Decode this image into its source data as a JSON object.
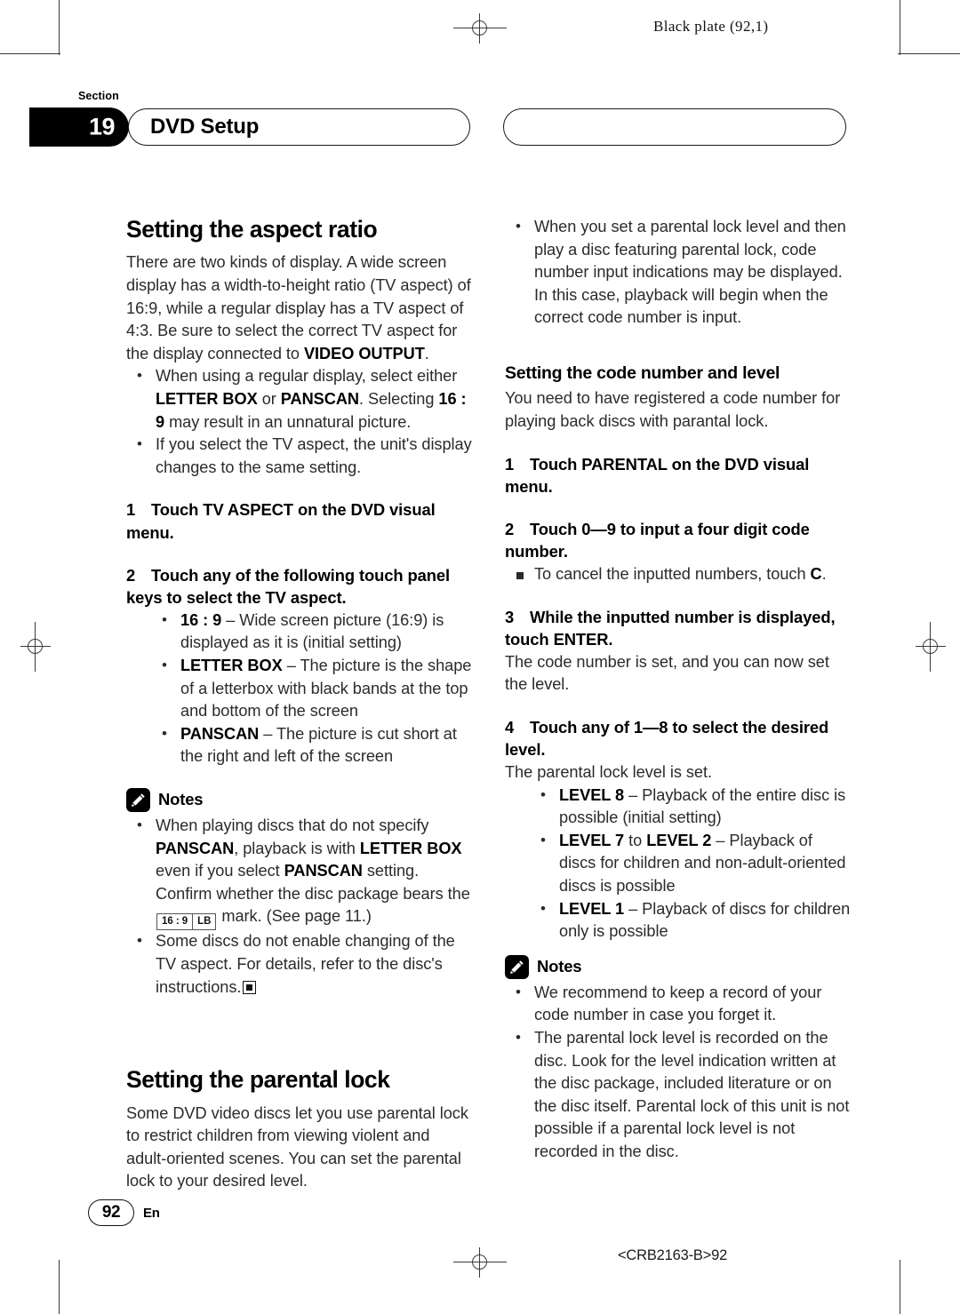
{
  "plate_label": "Black plate (92,1)",
  "header": {
    "section_word": "Section",
    "section_number": "19",
    "left_tab_title": "DVD Setup",
    "right_tab_title": ""
  },
  "left_column": {
    "heading": "Setting the aspect ratio",
    "intro_html": "There are two kinds of display. A wide screen display has a width-to-height ratio (TV aspect) of 16:9, while a regular display has a TV aspect of 4:3. Be sure to select the correct TV aspect for the display connected to <b>VIDEO OUTPUT</b>.",
    "intro_bullets_html": [
      "When using a regular display, select either <b>LETTER BOX</b> or <b>PANSCAN</b>. Selecting <b>16 : 9</b> may result in an unnatural picture.",
      "If you select the TV aspect, the unit's display changes to the same setting."
    ],
    "step1": "Touch TV ASPECT on the DVD visual menu.",
    "step1_num": "1",
    "step2": "Touch any of the following touch panel keys to select the TV aspect.",
    "step2_num": "2",
    "step2_bullets_html": [
      "<b>16 : 9</b> – Wide screen picture (16:9) is displayed as it is (initial setting)",
      "<b>LETTER BOX</b> – The picture is the shape of a letterbox with black bands at the top and bottom of the screen",
      "<b>PANSCAN</b> – The picture is cut short at the right and left of the screen"
    ],
    "notes_label": "Notes",
    "notes_html": [
      "When playing discs that do not specify <b>PANSCAN</b>, playback is with <b>LETTER BOX</b> even if you select <b>PANSCAN</b> setting. Confirm whether the disc package bears the <span class=\"mark169\"><span>16 : 9</span><span class=\"sep\">LB</span></span> mark. (See page 11.)",
      "Some discs do not enable changing of the TV aspect. For details, refer to the disc's instructions.<span class=\"endmark\"></span>"
    ],
    "heading2": "Setting the parental lock",
    "intro2": "Some DVD video discs let you use parental lock to restrict children from viewing violent and adult-oriented scenes. You can set the parental lock to your desired level."
  },
  "right_column": {
    "top_bullets_html": [
      "When you set a parental lock level and then play a disc featuring parental lock, code number input indications may be displayed. In this case, playback will begin when the correct code number is input."
    ],
    "heading": "Setting the code number and level",
    "intro": "You need to have registered a code number for playing back discs with parantal lock.",
    "step1_num": "1",
    "step1": "Touch PARENTAL on the DVD visual menu.",
    "step2_num": "2",
    "step2": "Touch 0—9 to input a four digit code number.",
    "step2_sub_html": [
      "To cancel the inputted numbers, touch <b>C</b>."
    ],
    "step3_num": "3",
    "step3": "While the inputted number is displayed, touch ENTER.",
    "step3_body": "The code number is set, and you can now set the level.",
    "step4_num": "4",
    "step4": "Touch any of 1—8 to select the desired level.",
    "step4_body": "The parental lock level is set.",
    "step4_bullets_html": [
      "<b>LEVEL 8</b> – Playback of the entire disc is possible (initial setting)",
      "<b>LEVEL 7</b> to <b>LEVEL 2</b> – Playback of discs for children and non-adult-oriented discs is possible",
      "<b>LEVEL 1</b> – Playback of discs for children only is possible"
    ],
    "notes_label": "Notes",
    "notes_html": [
      "We recommend to keep a record of your code number in case you forget it.",
      "The parental lock level is recorded on the disc. Look for the level indication written at the disc package, included literature or on the disc itself. Parental lock of this unit is not possible if a parental lock level is not recorded in the disc."
    ]
  },
  "footer": {
    "page_number": "92",
    "language": "En",
    "doc_id": "<CRB2163-B>92"
  },
  "colors": {
    "ink": "#000000",
    "body_text": "#2b2b2b",
    "rule": "#3a3a3a"
  }
}
